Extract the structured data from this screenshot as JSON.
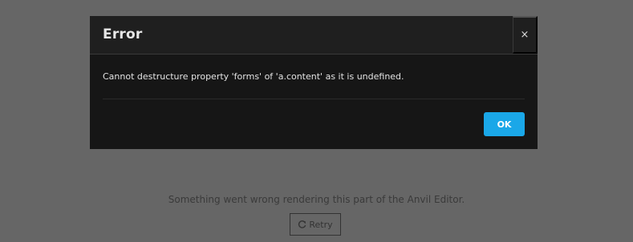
{
  "background": {
    "message": "Something went wrong rendering this part of the Anvil Editor.",
    "retry_label": "Retry",
    "retry_icon": "refresh-icon"
  },
  "modal": {
    "title": "Error",
    "close_label": "×",
    "message": "Cannot destructure property 'forms' of 'a.content' as it is undefined.",
    "ok_label": "OK"
  },
  "colors": {
    "overlay": "#666666",
    "modal_bg": "#161616",
    "header_bg": "#1f1f1f",
    "ok_accent": "#1aa7e8"
  }
}
